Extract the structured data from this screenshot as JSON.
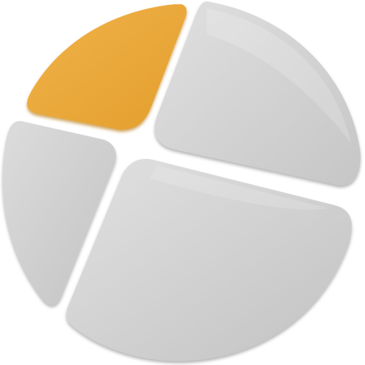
{
  "icon": {
    "name": "pie-chart-app-icon",
    "segments": [
      {
        "name": "segment-orange-top-left",
        "color": "#E9A73A"
      },
      {
        "name": "segment-gray-top-right",
        "color": "#CFCFCF"
      },
      {
        "name": "segment-gray-left",
        "color": "#CDCDCD"
      },
      {
        "name": "segment-gray-bottom-right",
        "color": "#D0D0D0"
      }
    ],
    "colors": {
      "accent": "#E9A73A",
      "accent_shadow": "#C98712",
      "gray_light": "#D9D9D9",
      "gray_mid": "#BDBDBD",
      "gray_shadow": "#9E9E9E"
    }
  }
}
